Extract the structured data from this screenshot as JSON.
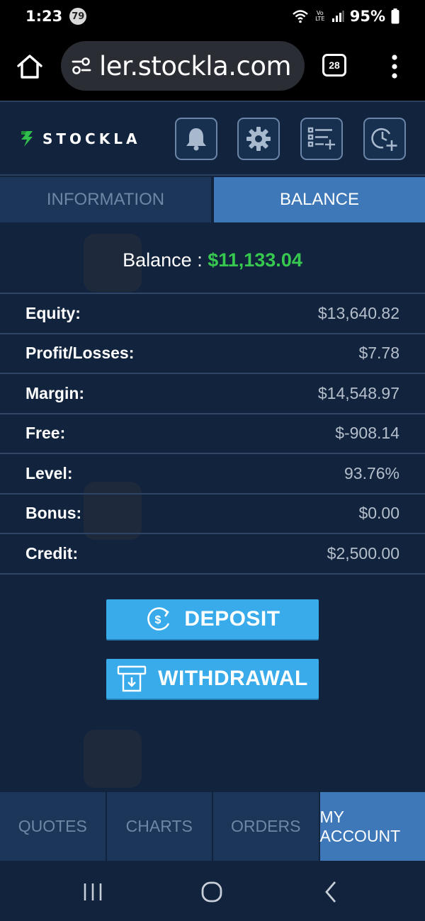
{
  "status_bar": {
    "time": "1:23",
    "notification_count": "79",
    "volte_label": "Vo LTE",
    "battery": "95%"
  },
  "browser": {
    "url": "ler.stockla.com",
    "tab_count": "28"
  },
  "header": {
    "logo_text": "STOCKLA",
    "buttons": [
      "bell-icon",
      "gear-icon",
      "add-list-icon",
      "add-clock-icon"
    ]
  },
  "tabs": {
    "information": "INFORMATION",
    "balance": "BALANCE"
  },
  "balance": {
    "label": "Balance : ",
    "value": "$11,133.04"
  },
  "account_rows": [
    {
      "label": "Equity:",
      "value": "$13,640.82"
    },
    {
      "label": "Profit/Losses:",
      "value": "$7.78"
    },
    {
      "label": "Margin:",
      "value": "$14,548.97"
    },
    {
      "label": "Free:",
      "value": "$-908.14"
    },
    {
      "label": "Level:",
      "value": "93.76%"
    },
    {
      "label": "Bonus:",
      "value": "$0.00"
    },
    {
      "label": "Credit:",
      "value": "$2,500.00"
    }
  ],
  "actions": {
    "deposit": "DEPOSIT",
    "withdrawal": "WITHDRAWAL"
  },
  "bottom_nav": {
    "quotes": "QUOTES",
    "charts": "CHARTS",
    "orders": "ORDERS",
    "my_account": "MY ACCOUNT"
  },
  "colors": {
    "background": "#12233d",
    "active_tab": "#3f78b8",
    "inactive_tab": "#1b3659",
    "balance_green": "#37c84f",
    "action_button": "#3aabea"
  }
}
